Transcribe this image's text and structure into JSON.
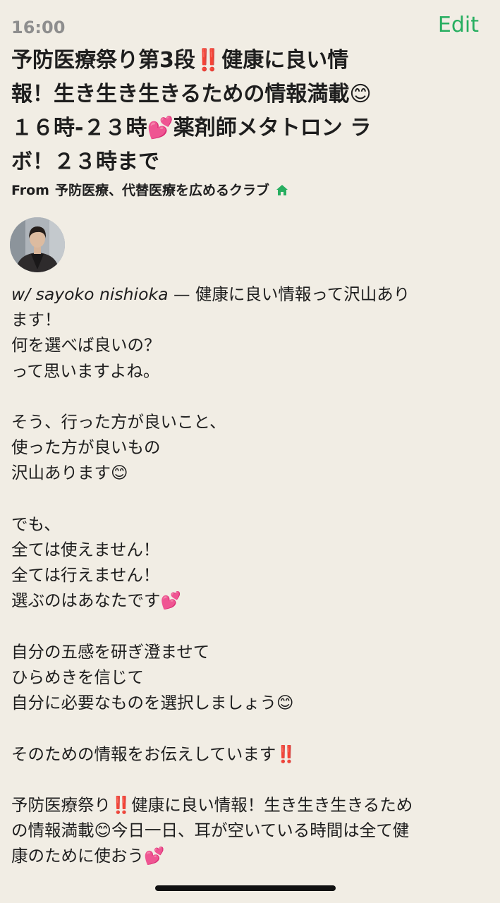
{
  "status_bar": {
    "time": "16:00"
  },
  "header": {
    "edit_label": "Edit"
  },
  "event": {
    "title": "予防医療祭り第3段‼️健康に良い情\n報！生き生き生きるための情報満載😊\n１６時-２３時💕薬剤師メタトロン ラ\nボ！２３時まで",
    "from_prefix": "From",
    "club_name": "予防医療、代替医療を広めるクラブ",
    "home_icon": "home-icon",
    "host_prefix": "w/ sayoko nishioka",
    "description": " — 健康に良い情報って沢山あり\nます！\n何を選べば良いの？\nって思いますよね。\n\nそう、行った方が良いこと、\n使った方が良いもの\n沢山あります😊\n\nでも、\n全ては使えません！\n全ては行えません！\n選ぶのはあなたです💕\n\n自分の五感を研ぎ澄ませて\nひらめきを信じて\n自分に必要なものを選択しましょう😊\n\nそのための情報をお伝えしています‼️\n\n予防医療祭り‼️健康に良い情報！生き生き生きるため\nの情報満載😊今日一日、耳が空いている時間は全て健\n康のために使おう💕"
  },
  "colors": {
    "accent": "#27ae60",
    "background": "#f1ede4",
    "time": "#8e8e8e"
  }
}
